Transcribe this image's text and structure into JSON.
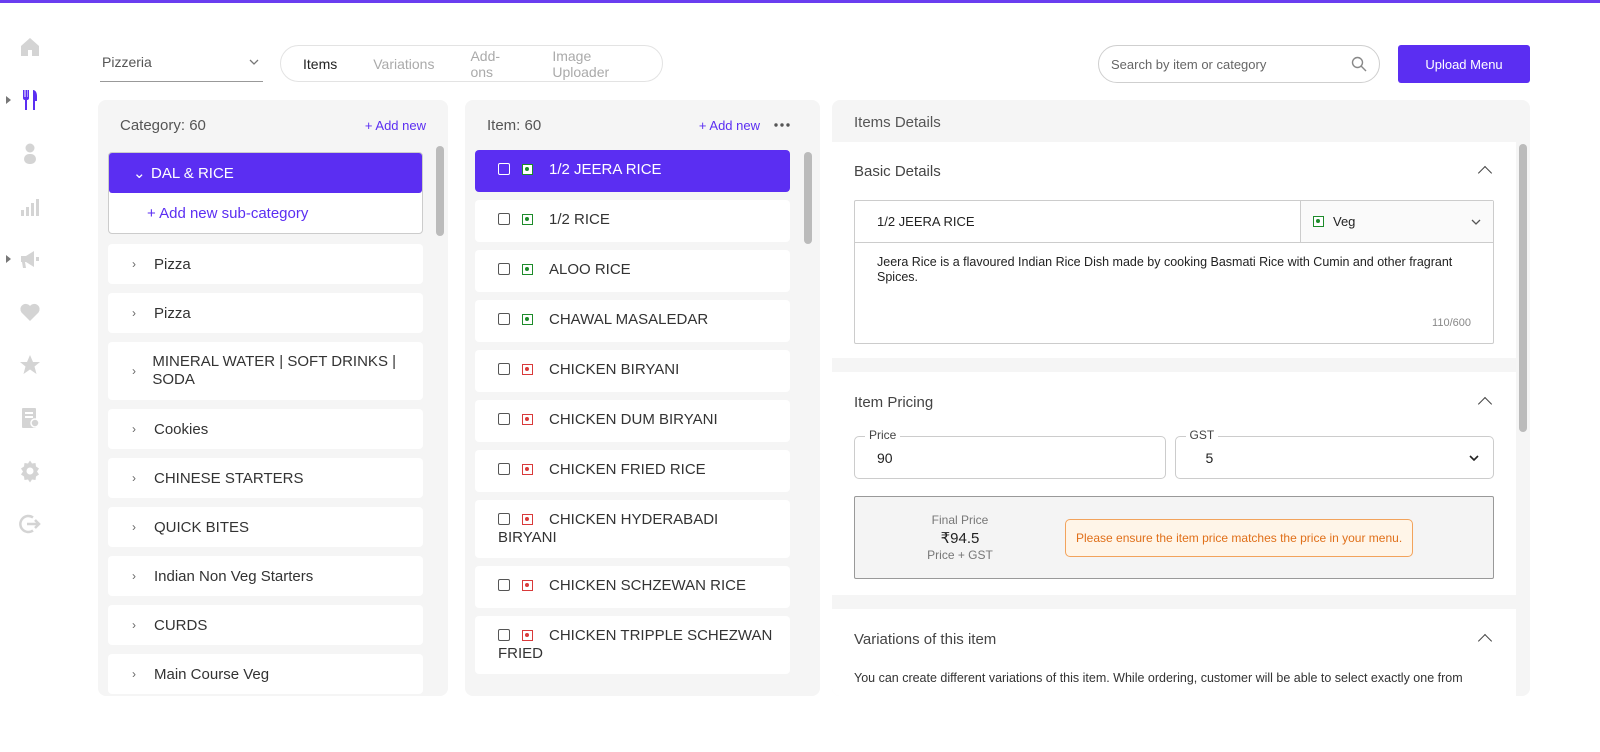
{
  "colors": {
    "accent": "#5b2ef2",
    "veg": "#1d8b2a",
    "nonveg": "#d93a3a",
    "warning": "#e0701a"
  },
  "rail": [
    "home-icon",
    "restaurant-menu-icon",
    "user-icon",
    "analytics-icon",
    "promotions-icon",
    "favorites-icon",
    "star-icon",
    "receipt-icon",
    "settings-icon",
    "logout-icon"
  ],
  "header": {
    "restaurant": "Pizzeria",
    "tabs": [
      "Items",
      "Variations",
      "Add-ons",
      "Image Uploader"
    ],
    "search_placeholder": "Search by item or category",
    "upload_label": "Upload Menu"
  },
  "categories": {
    "title": "Category: 60",
    "add_new": "+ Add new",
    "active": "DAL & RICE",
    "add_sub": "+ Add new sub-category",
    "items": [
      "Pizza",
      "Pizza",
      "MINERAL WATER | SOFT DRINKS | SODA",
      "Cookies",
      "CHINESE STARTERS",
      "QUICK BITES",
      "Indian Non Veg Starters",
      "CURDS",
      "Main Course Veg"
    ]
  },
  "items": {
    "title": "Item: 60",
    "add_new": "+ Add new",
    "list": [
      {
        "name": "1/2 JEERA RICE",
        "type": "veg"
      },
      {
        "name": "1/2 RICE",
        "type": "veg"
      },
      {
        "name": "ALOO RICE",
        "type": "veg"
      },
      {
        "name": "CHAWAL MASALEDAR",
        "type": "veg"
      },
      {
        "name": "CHICKEN BIRYANI",
        "type": "nonveg"
      },
      {
        "name": "CHICKEN DUM BIRYANI",
        "type": "nonveg"
      },
      {
        "name": "CHICKEN FRIED RICE",
        "type": "nonveg"
      },
      {
        "name": "CHICKEN HYDERABADI BIRYANI",
        "type": "nonveg"
      },
      {
        "name": "CHICKEN SCHZEWAN RICE",
        "type": "nonveg"
      },
      {
        "name": "CHICKEN TRIPPLE SCHEZWAN FRIED",
        "type": "nonveg"
      }
    ]
  },
  "details": {
    "title": "Items Details",
    "basic_title": "Basic Details",
    "name": "1/2 JEERA RICE",
    "veg_label": "Veg",
    "description": "Jeera Rice is a flavoured Indian Rice Dish made by cooking Basmati Rice with Cumin and other fragrant Spices.",
    "counter": "110/600",
    "pricing_title": "Item Pricing",
    "price_label": "Price",
    "price": "90",
    "gst_label": "GST",
    "gst": "5",
    "final_label": "Final Price",
    "final_value": "₹94.5",
    "final_sub": "Price + GST",
    "warning": "Please ensure the item price matches the price in your menu.",
    "variations_title": "Variations of this item",
    "variations_desc": "You can create different variations of this item. While ordering, customer will be able to select exactly one from"
  }
}
